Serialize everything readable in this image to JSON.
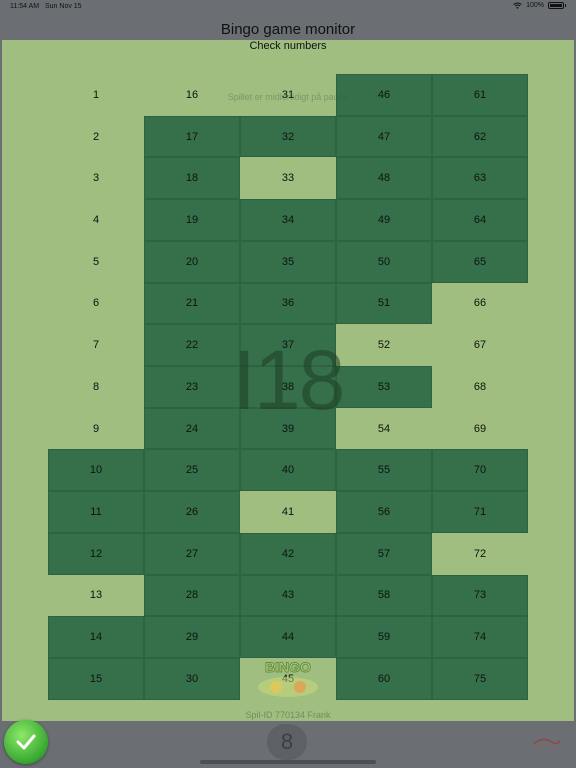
{
  "status_bar": {
    "time": "11:54 AM",
    "date": "Sun Nov 15",
    "battery": "100%"
  },
  "header": {
    "title": "Bingo game monitor",
    "subtitle": "Check numbers"
  },
  "overlays": {
    "paused_text": "Spillet er midlertidigt på pause",
    "last_called": "I18",
    "game_id": "Spil-ID 770134 Frank",
    "logo_line1": "BINGO",
    "logo_line2": "45"
  },
  "colors": {
    "background_panel": "#9fbe7f",
    "marked_cell": "#35704b",
    "app_background": "#6b6f73",
    "ok_button": "#36a82e"
  },
  "grid": {
    "columns": [
      [
        {
          "n": "1",
          "m": false
        },
        {
          "n": "2",
          "m": false
        },
        {
          "n": "3",
          "m": false
        },
        {
          "n": "4",
          "m": false
        },
        {
          "n": "5",
          "m": false
        },
        {
          "n": "6",
          "m": false
        },
        {
          "n": "7",
          "m": false
        },
        {
          "n": "8",
          "m": false
        },
        {
          "n": "9",
          "m": false
        },
        {
          "n": "10",
          "m": true
        },
        {
          "n": "11",
          "m": true
        },
        {
          "n": "12",
          "m": true
        },
        {
          "n": "13",
          "m": false
        },
        {
          "n": "14",
          "m": true
        },
        {
          "n": "15",
          "m": true
        }
      ],
      [
        {
          "n": "16",
          "m": false
        },
        {
          "n": "17",
          "m": true
        },
        {
          "n": "18",
          "m": true
        },
        {
          "n": "19",
          "m": true
        },
        {
          "n": "20",
          "m": true
        },
        {
          "n": "21",
          "m": true
        },
        {
          "n": "22",
          "m": true
        },
        {
          "n": "23",
          "m": true
        },
        {
          "n": "24",
          "m": true
        },
        {
          "n": "25",
          "m": true
        },
        {
          "n": "26",
          "m": true
        },
        {
          "n": "27",
          "m": true
        },
        {
          "n": "28",
          "m": true
        },
        {
          "n": "29",
          "m": true
        },
        {
          "n": "30",
          "m": true
        }
      ],
      [
        {
          "n": "31",
          "m": false
        },
        {
          "n": "32",
          "m": true
        },
        {
          "n": "33",
          "m": false
        },
        {
          "n": "34",
          "m": true
        },
        {
          "n": "35",
          "m": true
        },
        {
          "n": "36",
          "m": true
        },
        {
          "n": "37",
          "m": true
        },
        {
          "n": "38",
          "m": true
        },
        {
          "n": "39",
          "m": true
        },
        {
          "n": "40",
          "m": true
        },
        {
          "n": "41",
          "m": false
        },
        {
          "n": "42",
          "m": true
        },
        {
          "n": "43",
          "m": true
        },
        {
          "n": "44",
          "m": true
        },
        {
          "n": "45",
          "m": false
        }
      ],
      [
        {
          "n": "46",
          "m": true
        },
        {
          "n": "47",
          "m": true
        },
        {
          "n": "48",
          "m": true
        },
        {
          "n": "49",
          "m": true
        },
        {
          "n": "50",
          "m": true
        },
        {
          "n": "51",
          "m": true
        },
        {
          "n": "52",
          "m": false
        },
        {
          "n": "53",
          "m": true
        },
        {
          "n": "54",
          "m": false
        },
        {
          "n": "55",
          "m": true
        },
        {
          "n": "56",
          "m": true
        },
        {
          "n": "57",
          "m": true
        },
        {
          "n": "58",
          "m": true
        },
        {
          "n": "59",
          "m": true
        },
        {
          "n": "60",
          "m": true
        }
      ],
      [
        {
          "n": "61",
          "m": true
        },
        {
          "n": "62",
          "m": true
        },
        {
          "n": "63",
          "m": true
        },
        {
          "n": "64",
          "m": true
        },
        {
          "n": "65",
          "m": true
        },
        {
          "n": "66",
          "m": false
        },
        {
          "n": "67",
          "m": false
        },
        {
          "n": "68",
          "m": false
        },
        {
          "n": "69",
          "m": false
        },
        {
          "n": "70",
          "m": true
        },
        {
          "n": "71",
          "m": true
        },
        {
          "n": "72",
          "m": false
        },
        {
          "n": "73",
          "m": true
        },
        {
          "n": "74",
          "m": true
        },
        {
          "n": "75",
          "m": true
        }
      ]
    ]
  },
  "toolbar": {
    "ok_icon": "checkmark-icon",
    "center_icon": "number-8-icon",
    "center_label": "8",
    "brand_icon": "brand-logo-icon"
  }
}
